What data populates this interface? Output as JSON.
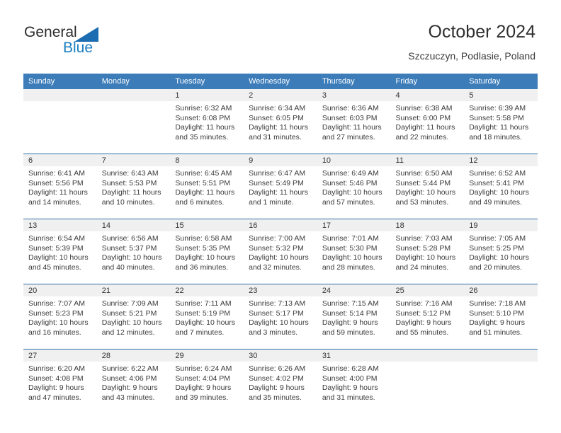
{
  "brand": {
    "word_general": "General",
    "word_blue": "Blue",
    "triangle_icon": "blue-triangle-logo-icon",
    "accent_color": "#1b7ec2"
  },
  "header": {
    "title": "October 2024",
    "subtitle": "Szczuczyn, Podlasie, Poland"
  },
  "calendar": {
    "header_color": "#3b7cb9",
    "daynum_band_color": "#f0f0f0",
    "row_divider_color": "#2f6ea8",
    "weekday_headers": [
      "Sunday",
      "Monday",
      "Tuesday",
      "Wednesday",
      "Thursday",
      "Friday",
      "Saturday"
    ],
    "weeks": [
      [
        {
          "day": "",
          "sunrise": "",
          "sunset": "",
          "daylight_line1": "",
          "daylight_line2": ""
        },
        {
          "day": "",
          "sunrise": "",
          "sunset": "",
          "daylight_line1": "",
          "daylight_line2": ""
        },
        {
          "day": "1",
          "sunrise": "Sunrise: 6:32 AM",
          "sunset": "Sunset: 6:08 PM",
          "daylight_line1": "Daylight: 11 hours",
          "daylight_line2": "and 35 minutes."
        },
        {
          "day": "2",
          "sunrise": "Sunrise: 6:34 AM",
          "sunset": "Sunset: 6:05 PM",
          "daylight_line1": "Daylight: 11 hours",
          "daylight_line2": "and 31 minutes."
        },
        {
          "day": "3",
          "sunrise": "Sunrise: 6:36 AM",
          "sunset": "Sunset: 6:03 PM",
          "daylight_line1": "Daylight: 11 hours",
          "daylight_line2": "and 27 minutes."
        },
        {
          "day": "4",
          "sunrise": "Sunrise: 6:38 AM",
          "sunset": "Sunset: 6:00 PM",
          "daylight_line1": "Daylight: 11 hours",
          "daylight_line2": "and 22 minutes."
        },
        {
          "day": "5",
          "sunrise": "Sunrise: 6:39 AM",
          "sunset": "Sunset: 5:58 PM",
          "daylight_line1": "Daylight: 11 hours",
          "daylight_line2": "and 18 minutes."
        }
      ],
      [
        {
          "day": "6",
          "sunrise": "Sunrise: 6:41 AM",
          "sunset": "Sunset: 5:56 PM",
          "daylight_line1": "Daylight: 11 hours",
          "daylight_line2": "and 14 minutes."
        },
        {
          "day": "7",
          "sunrise": "Sunrise: 6:43 AM",
          "sunset": "Sunset: 5:53 PM",
          "daylight_line1": "Daylight: 11 hours",
          "daylight_line2": "and 10 minutes."
        },
        {
          "day": "8",
          "sunrise": "Sunrise: 6:45 AM",
          "sunset": "Sunset: 5:51 PM",
          "daylight_line1": "Daylight: 11 hours",
          "daylight_line2": "and 6 minutes."
        },
        {
          "day": "9",
          "sunrise": "Sunrise: 6:47 AM",
          "sunset": "Sunset: 5:49 PM",
          "daylight_line1": "Daylight: 11 hours",
          "daylight_line2": "and 1 minute."
        },
        {
          "day": "10",
          "sunrise": "Sunrise: 6:49 AM",
          "sunset": "Sunset: 5:46 PM",
          "daylight_line1": "Daylight: 10 hours",
          "daylight_line2": "and 57 minutes."
        },
        {
          "day": "11",
          "sunrise": "Sunrise: 6:50 AM",
          "sunset": "Sunset: 5:44 PM",
          "daylight_line1": "Daylight: 10 hours",
          "daylight_line2": "and 53 minutes."
        },
        {
          "day": "12",
          "sunrise": "Sunrise: 6:52 AM",
          "sunset": "Sunset: 5:41 PM",
          "daylight_line1": "Daylight: 10 hours",
          "daylight_line2": "and 49 minutes."
        }
      ],
      [
        {
          "day": "13",
          "sunrise": "Sunrise: 6:54 AM",
          "sunset": "Sunset: 5:39 PM",
          "daylight_line1": "Daylight: 10 hours",
          "daylight_line2": "and 45 minutes."
        },
        {
          "day": "14",
          "sunrise": "Sunrise: 6:56 AM",
          "sunset": "Sunset: 5:37 PM",
          "daylight_line1": "Daylight: 10 hours",
          "daylight_line2": "and 40 minutes."
        },
        {
          "day": "15",
          "sunrise": "Sunrise: 6:58 AM",
          "sunset": "Sunset: 5:35 PM",
          "daylight_line1": "Daylight: 10 hours",
          "daylight_line2": "and 36 minutes."
        },
        {
          "day": "16",
          "sunrise": "Sunrise: 7:00 AM",
          "sunset": "Sunset: 5:32 PM",
          "daylight_line1": "Daylight: 10 hours",
          "daylight_line2": "and 32 minutes."
        },
        {
          "day": "17",
          "sunrise": "Sunrise: 7:01 AM",
          "sunset": "Sunset: 5:30 PM",
          "daylight_line1": "Daylight: 10 hours",
          "daylight_line2": "and 28 minutes."
        },
        {
          "day": "18",
          "sunrise": "Sunrise: 7:03 AM",
          "sunset": "Sunset: 5:28 PM",
          "daylight_line1": "Daylight: 10 hours",
          "daylight_line2": "and 24 minutes."
        },
        {
          "day": "19",
          "sunrise": "Sunrise: 7:05 AM",
          "sunset": "Sunset: 5:25 PM",
          "daylight_line1": "Daylight: 10 hours",
          "daylight_line2": "and 20 minutes."
        }
      ],
      [
        {
          "day": "20",
          "sunrise": "Sunrise: 7:07 AM",
          "sunset": "Sunset: 5:23 PM",
          "daylight_line1": "Daylight: 10 hours",
          "daylight_line2": "and 16 minutes."
        },
        {
          "day": "21",
          "sunrise": "Sunrise: 7:09 AM",
          "sunset": "Sunset: 5:21 PM",
          "daylight_line1": "Daylight: 10 hours",
          "daylight_line2": "and 12 minutes."
        },
        {
          "day": "22",
          "sunrise": "Sunrise: 7:11 AM",
          "sunset": "Sunset: 5:19 PM",
          "daylight_line1": "Daylight: 10 hours",
          "daylight_line2": "and 7 minutes."
        },
        {
          "day": "23",
          "sunrise": "Sunrise: 7:13 AM",
          "sunset": "Sunset: 5:17 PM",
          "daylight_line1": "Daylight: 10 hours",
          "daylight_line2": "and 3 minutes."
        },
        {
          "day": "24",
          "sunrise": "Sunrise: 7:15 AM",
          "sunset": "Sunset: 5:14 PM",
          "daylight_line1": "Daylight: 9 hours",
          "daylight_line2": "and 59 minutes."
        },
        {
          "day": "25",
          "sunrise": "Sunrise: 7:16 AM",
          "sunset": "Sunset: 5:12 PM",
          "daylight_line1": "Daylight: 9 hours",
          "daylight_line2": "and 55 minutes."
        },
        {
          "day": "26",
          "sunrise": "Sunrise: 7:18 AM",
          "sunset": "Sunset: 5:10 PM",
          "daylight_line1": "Daylight: 9 hours",
          "daylight_line2": "and 51 minutes."
        }
      ],
      [
        {
          "day": "27",
          "sunrise": "Sunrise: 6:20 AM",
          "sunset": "Sunset: 4:08 PM",
          "daylight_line1": "Daylight: 9 hours",
          "daylight_line2": "and 47 minutes."
        },
        {
          "day": "28",
          "sunrise": "Sunrise: 6:22 AM",
          "sunset": "Sunset: 4:06 PM",
          "daylight_line1": "Daylight: 9 hours",
          "daylight_line2": "and 43 minutes."
        },
        {
          "day": "29",
          "sunrise": "Sunrise: 6:24 AM",
          "sunset": "Sunset: 4:04 PM",
          "daylight_line1": "Daylight: 9 hours",
          "daylight_line2": "and 39 minutes."
        },
        {
          "day": "30",
          "sunrise": "Sunrise: 6:26 AM",
          "sunset": "Sunset: 4:02 PM",
          "daylight_line1": "Daylight: 9 hours",
          "daylight_line2": "and 35 minutes."
        },
        {
          "day": "31",
          "sunrise": "Sunrise: 6:28 AM",
          "sunset": "Sunset: 4:00 PM",
          "daylight_line1": "Daylight: 9 hours",
          "daylight_line2": "and 31 minutes."
        },
        {
          "day": "",
          "sunrise": "",
          "sunset": "",
          "daylight_line1": "",
          "daylight_line2": ""
        },
        {
          "day": "",
          "sunrise": "",
          "sunset": "",
          "daylight_line1": "",
          "daylight_line2": ""
        }
      ]
    ]
  }
}
